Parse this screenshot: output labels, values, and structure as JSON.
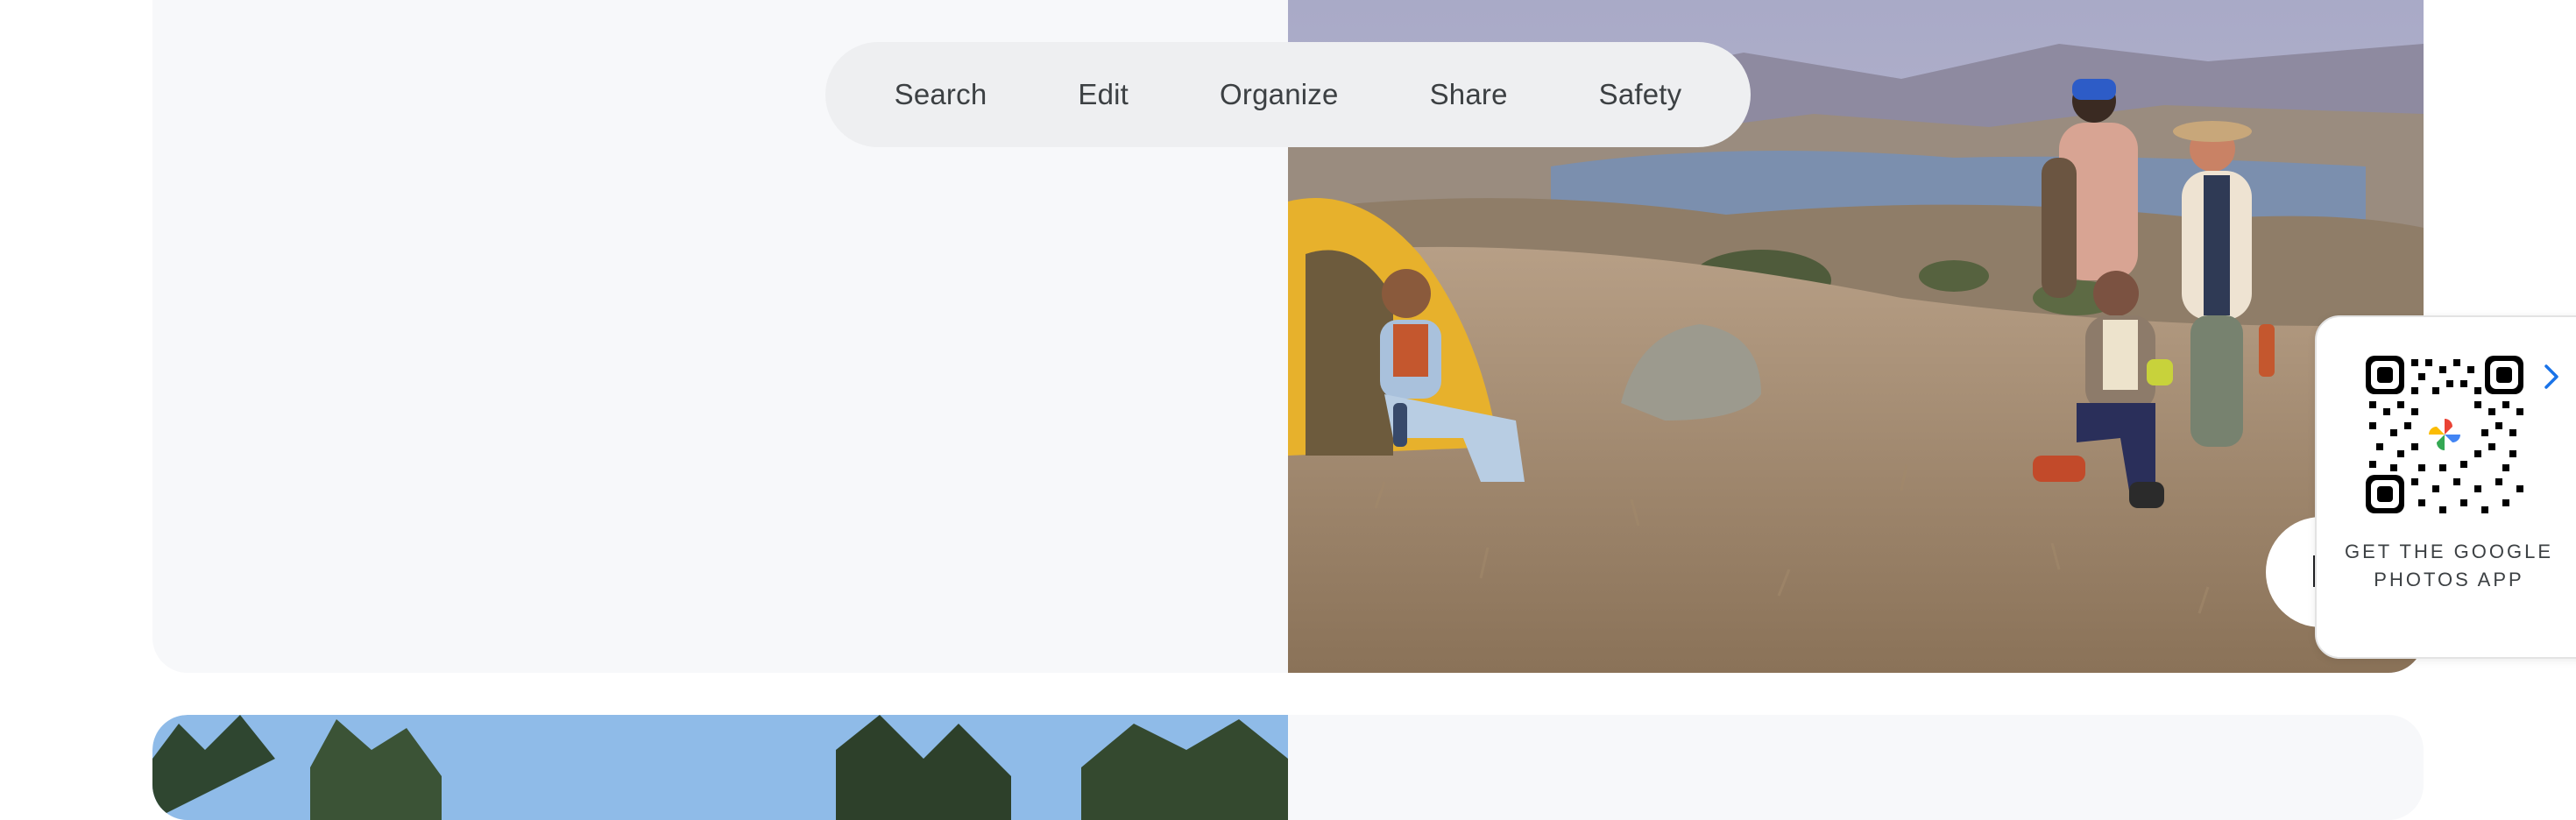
{
  "feature_nav": {
    "items": [
      {
        "label": "Search"
      },
      {
        "label": "Edit"
      },
      {
        "label": "Organize"
      },
      {
        "label": "Share"
      },
      {
        "label": "Safety"
      }
    ]
  },
  "hero": {
    "image": "photo-icon"
  },
  "qr_promo": {
    "caption": "GET THE GOOGLE PHOTOS APP",
    "qr_icon": "qr-code-icon",
    "chevron_icon": "chevron-right-icon",
    "logo_icon": "google-photos-pinwheel-icon",
    "accent": "#1a73e8"
  },
  "colors": {
    "card_background": "#f7f8fa",
    "nav_background": "#eeeff1",
    "text": "#3c4043"
  }
}
